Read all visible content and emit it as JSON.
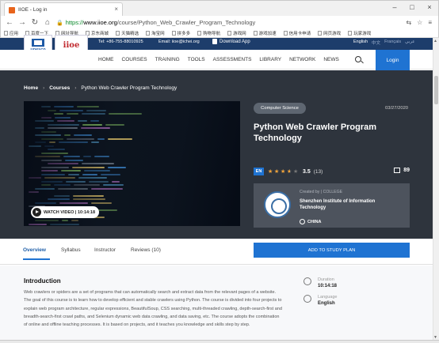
{
  "browser": {
    "tab_title": "IIOE - Log in",
    "url_scheme": "https://",
    "url_host": "www.iioe.org",
    "url_path": "/course/Python_Web_Crawler_Program_Technology",
    "bookmarks": [
      "应用",
      "百度一下",
      "网址导航",
      "京东商城",
      "天猫精选",
      "淘宝网",
      "拼多多",
      "购物导航",
      "游戏网",
      "游戏加速",
      "信用卡申请",
      "网页游戏",
      "玩家游戏"
    ]
  },
  "header": {
    "logo_left": "unesco",
    "logo_right": "iioe",
    "tel": "Tel: +86-755-88010925",
    "email": "Email: iioe@ichei.org",
    "download_app": "Download App",
    "languages": [
      {
        "label": "English",
        "active": true
      },
      {
        "label": "中文",
        "active": false
      },
      {
        "label": "Français",
        "active": false
      },
      {
        "label": "عربي",
        "active": false
      }
    ],
    "nav": [
      "HOME",
      "COURSES",
      "TRAINING",
      "TOOLS",
      "ASSESSMENTS",
      "LIBRARY",
      "NETWORK",
      "NEWS"
    ],
    "login": "Login"
  },
  "breadcrumb": {
    "home": "Home",
    "courses": "Courses",
    "current": "Python Web Crawler Program Technology"
  },
  "course": {
    "category": "Computer Science",
    "date": "03/27/2020",
    "title": "Python Web Crawler Program Technology",
    "language_badge": "EN",
    "rating": 3.5,
    "rating_text": "3.5",
    "rating_count": "(13)",
    "learners": "89",
    "video_label": "WATCH VIDEO | 10:14:18",
    "created_by": "Created by | COLLEGE",
    "institution": "Shenzhen Institute of Information Technology",
    "country": "CHINA"
  },
  "tabs": [
    {
      "label": "Overview",
      "active": true
    },
    {
      "label": "Syllabus",
      "active": false
    },
    {
      "label": "Instructor",
      "active": false
    },
    {
      "label": "Reviews (10)",
      "active": false
    }
  ],
  "cta": "ADD TO STUDY PLAN",
  "intro": {
    "heading": "Introduction",
    "text": "Web crawlers or spiders are a set of programs that can automatically search and extract data from the relevant pages of a website. The goal of this course is to learn how to develop efficient and stable crawlers using Python. The course is divided into four projects to explain web program architecture, regular expressions, BeautifulSoup, CSS searching, multi-threaded crawling, depth-search-first and breadth-search-first crawl paths, and Selenium dynamic web data crawling, and data saving, etc. The course adopts the combination of online and offline teaching processes. It is based on projects, and it teaches you knowledge and skills step by step."
  },
  "meta": {
    "duration_label": "Duration",
    "duration_value": "10:14:18",
    "language_label": "Language",
    "language_value": "English"
  },
  "colors": {
    "brand_blue": "#1f73d2",
    "header_navy": "#1d3d6b",
    "hero_bg": "#2e343d",
    "star": "#f0a238"
  }
}
